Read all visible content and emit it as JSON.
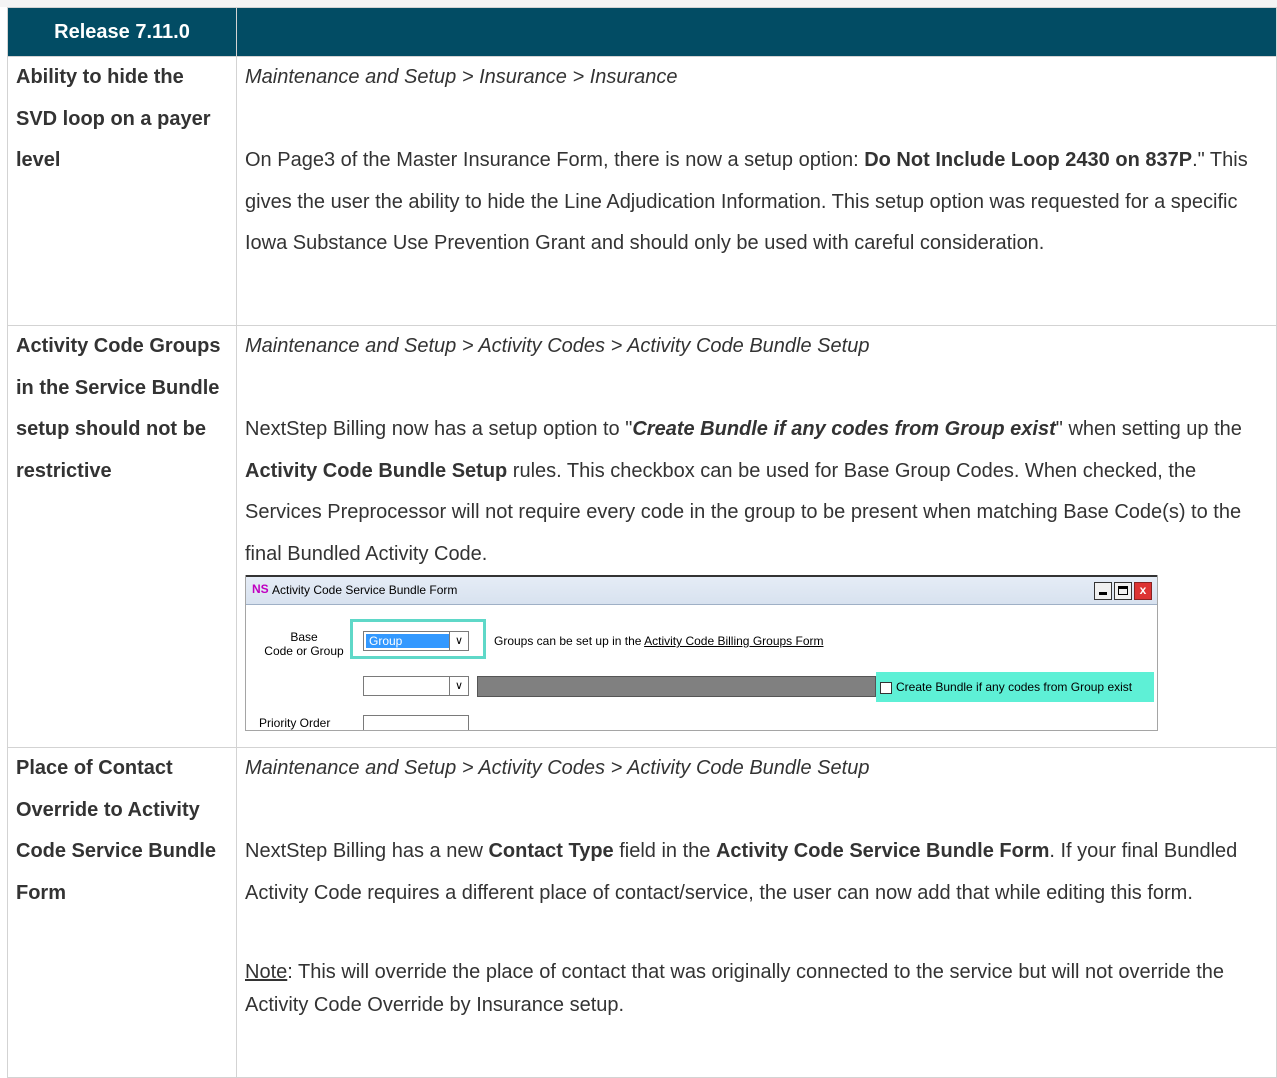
{
  "header": {
    "col1": "Release 7.11.0",
    "col2": ""
  },
  "rows": [
    {
      "label": "Ability to hide the SVD loop on a payer level",
      "path": "Maintenance and Setup > Insurance > Insurance",
      "p1_a": "On Page3 of the Master Insurance Form, there is now a setup option: ",
      "p1_b": "Do Not Include Loop 2430 on 837P",
      "p1_c": ".\" This gives the user the ability to hide the Line Adjudication Information. This setup option was requested for a specific Iowa Substance Use Prevention Grant and should only be used with careful consideration."
    },
    {
      "label": "Activity Code Groups in the Service Bundle setup should not be restrictive",
      "path": "Maintenance and Setup > Activity Codes > Activity Code Bundle Setup",
      "p1_a": "NextStep Billing now has a setup option to \"",
      "p1_b": "Create Bundle if any codes from Group exist",
      "p1_c": "\" when setting up the ",
      "p1_d": "Activity Code Bundle Setup",
      "p1_e": " rules. This checkbox can be used for Base Group Codes. When checked, the Services Preprocessor will not require every code in the group to be present when matching Base Code(s) to the final Bundled Activity Code."
    },
    {
      "label": "Place of Contact Override to Activity Code Service Bundle Form",
      "path": "Maintenance and Setup > Activity Codes > Activity Code Bundle Setup",
      "p1_a": "NextStep Billing has a new ",
      "p1_b": "Contact Type",
      "p1_c": " field in the ",
      "p1_d": "Activity Code Service Bundle Form",
      "p1_e": ". If your final Bundled Activity Code requires a different place of contact/service, the user can now add that while editing this form.",
      "note_label": "Note",
      "note_text": ": This will override the place of contact that was originally connected to the service but will not override the Activity Code Override by Insurance setup."
    }
  ],
  "screenshot": {
    "logo": "NS",
    "title": "Activity Code Service Bundle Form",
    "base_label_1": "Base",
    "base_label_2": "Code or Group",
    "group_value": "Group",
    "groups_text": "Groups can be set up in the ",
    "groups_link": "Activity Code Billing Groups Form",
    "checkbox_label": "Create Bundle if any codes from Group exist",
    "priority_label": "Priority Order",
    "close_glyph": "x"
  }
}
